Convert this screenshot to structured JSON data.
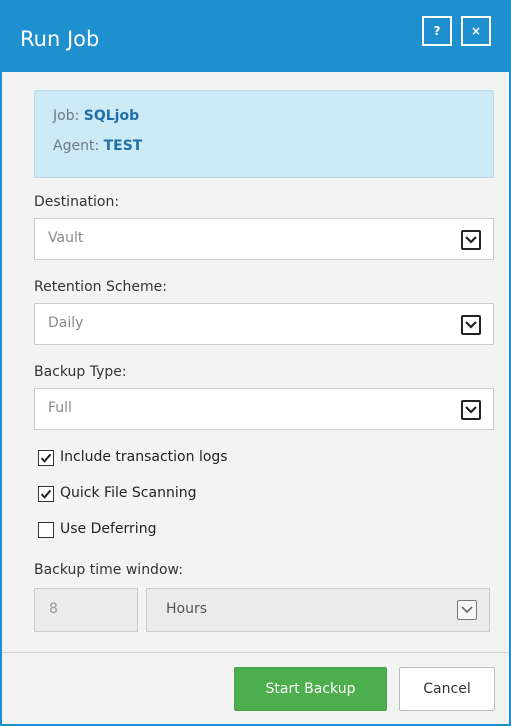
{
  "dialog": {
    "title": "Run Job",
    "help_label": "?",
    "close_label": "×"
  },
  "info": {
    "job_label": "Job: ",
    "job_value": "SQLjob",
    "agent_label": "Agent: ",
    "agent_value": "TEST"
  },
  "fields": {
    "destination": {
      "label": "Destination:",
      "value": "Vault"
    },
    "retention": {
      "label": "Retention Scheme:",
      "value": "Daily"
    },
    "backup_type": {
      "label": "Backup Type:",
      "value": "Full"
    }
  },
  "options": [
    {
      "label": "Include transaction logs",
      "checked": true
    },
    {
      "label": "Quick File Scanning",
      "checked": true
    },
    {
      "label": "Use Deferring",
      "checked": false
    }
  ],
  "time_window": {
    "label": "Backup time window:",
    "value": "8",
    "unit": "Hours"
  },
  "footer": {
    "start_label": "Start Backup",
    "cancel_label": "Cancel"
  },
  "colors": {
    "accent": "#1e8fcf",
    "info_bg": "#cde9f3",
    "primary_button": "#4cae4c"
  },
  "icons": {
    "help": "help-icon",
    "close": "close-icon",
    "dropdown": "chevron-down-icon",
    "checkbox": "checkmark-icon"
  }
}
